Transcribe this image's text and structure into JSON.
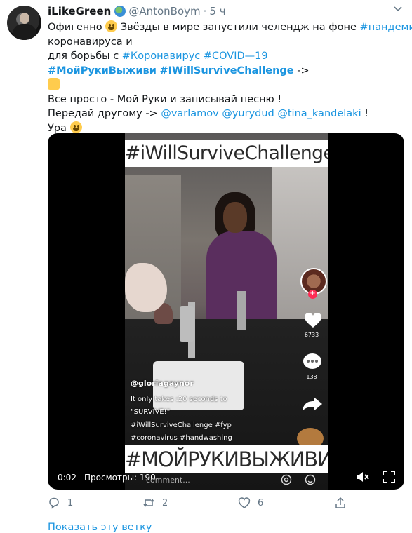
{
  "tweet": {
    "author_name": "iLikeGreen",
    "handle": "@AntonBoym",
    "time": "5 ч",
    "lines": [
      [
        "Офигенно ",
        ":emoji:",
        " Звёзды в мире запустили челендж на фоне ",
        "#пандемия"
      ],
      [
        " коронавируса и"
      ],
      [
        "для борьбы с ",
        "#Коронавирус",
        " ",
        "#COVID—19"
      ],
      [
        " ",
        "#МойРукиВыживи",
        " ",
        "#IWillSurviveChallenge",
        " ->"
      ],
      [
        ":thumb:"
      ],
      [
        "Все просто - Мой Руки и записывай песню !"
      ],
      [
        "Передай другому ->  ",
        "@varlamov",
        " ",
        "@yurydud",
        " ",
        "@tina_kandelaki",
        " !"
      ],
      [
        "Ура ",
        ":emoji:"
      ]
    ]
  },
  "video": {
    "top_banner": "#iWillSurviveChallenge",
    "bottom_banner": "#МОЙРУКИВЫЖИВИ",
    "overlay_user": "@gloriagaynor",
    "overlay_line1": "It only takes :20 seconds to",
    "overlay_line2": "\"SURVIVE!\"",
    "overlay_line3": "#iWillSurviveChallenge #fyp",
    "overlay_line4": "#coronavirus #handwashing",
    "comment_placeholder": "comment...",
    "likes_count": "6733",
    "comments_count": "138",
    "time": "0:02",
    "views": "Просмотры: 190"
  },
  "actions": {
    "replies": "1",
    "retweets": "2",
    "likes": "6"
  },
  "show_thread": "Показать эту ветку",
  "colors": {
    "link": "#1b95e0",
    "muted": "#657786"
  }
}
